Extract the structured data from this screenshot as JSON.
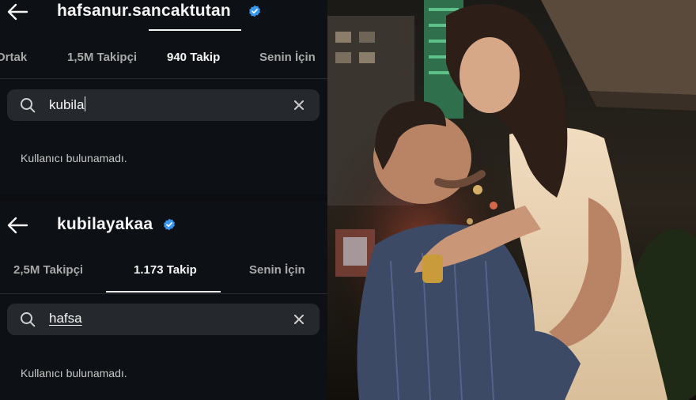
{
  "panels": [
    {
      "username": "hafsanur.sancaktutan",
      "tabs": [
        "Ortak",
        "1,5M Takipçi",
        "940 Takip",
        "Senin İçin"
      ],
      "active_tab": "940 Takip",
      "search_value": "kubila",
      "empty_text": "Kullanıcı bulunamadı."
    },
    {
      "username": "kubilayakaa",
      "tabs": [
        "2,5M Takipçi",
        "1.173 Takip",
        "Senin İçin"
      ],
      "active_tab": "1.173 Takip",
      "search_value": "hafsa",
      "empty_text": "Kullanıcı bulunamadı."
    }
  ],
  "icons": {
    "back": "arrow-left-icon",
    "verified": "verified-badge-icon",
    "search": "search-icon",
    "clear": "close-icon"
  },
  "colors": {
    "background": "#0d1014",
    "search_bg": "#25292e",
    "verified": "#3897f0",
    "muted_text": "#a8a8a8"
  }
}
